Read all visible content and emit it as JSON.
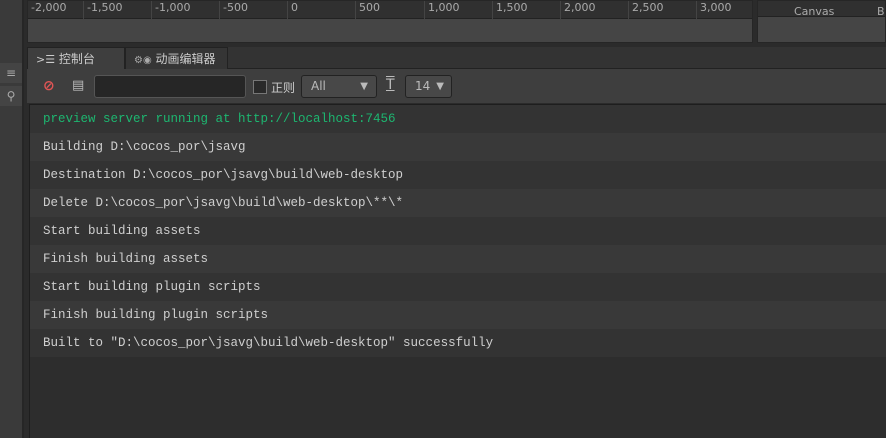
{
  "ruler": {
    "ticks": [
      "-2,000",
      "-1,500",
      "-1,000",
      "-500",
      "0",
      "500",
      "1,000",
      "1,500",
      "2,000",
      "2,500",
      "3,000"
    ]
  },
  "right_panel": {
    "label1": "Canvas",
    "label2": "B"
  },
  "tabs": [
    {
      "label": "控制台",
      "icon": "console-icon",
      "active": true
    },
    {
      "label": "动画编辑器",
      "icon": "animation-icon",
      "active": false
    }
  ],
  "toolbar": {
    "search_value": "",
    "search_placeholder": "",
    "regex_label": "正则",
    "regex_checked": false,
    "level_value": "All",
    "font_size_value": "14"
  },
  "logs": [
    {
      "text": "preview server running at http://localhost:7456",
      "type": "info-green"
    },
    {
      "text": "Building D:\\cocos_por\\jsavg",
      "type": "log"
    },
    {
      "text": "Destination D:\\cocos_por\\jsavg\\build\\web-desktop",
      "type": "log"
    },
    {
      "text": "Delete D:\\cocos_por\\jsavg\\build\\web-desktop\\**\\*",
      "type": "log"
    },
    {
      "text": "Start building assets",
      "type": "log"
    },
    {
      "text": "Finish building assets",
      "type": "log"
    },
    {
      "text": "Start building plugin scripts",
      "type": "log"
    },
    {
      "text": "Finish building plugin scripts",
      "type": "log"
    },
    {
      "text": "Built to \"D:\\cocos_por\\jsavg\\build\\web-desktop\" successfully",
      "type": "log"
    }
  ]
}
